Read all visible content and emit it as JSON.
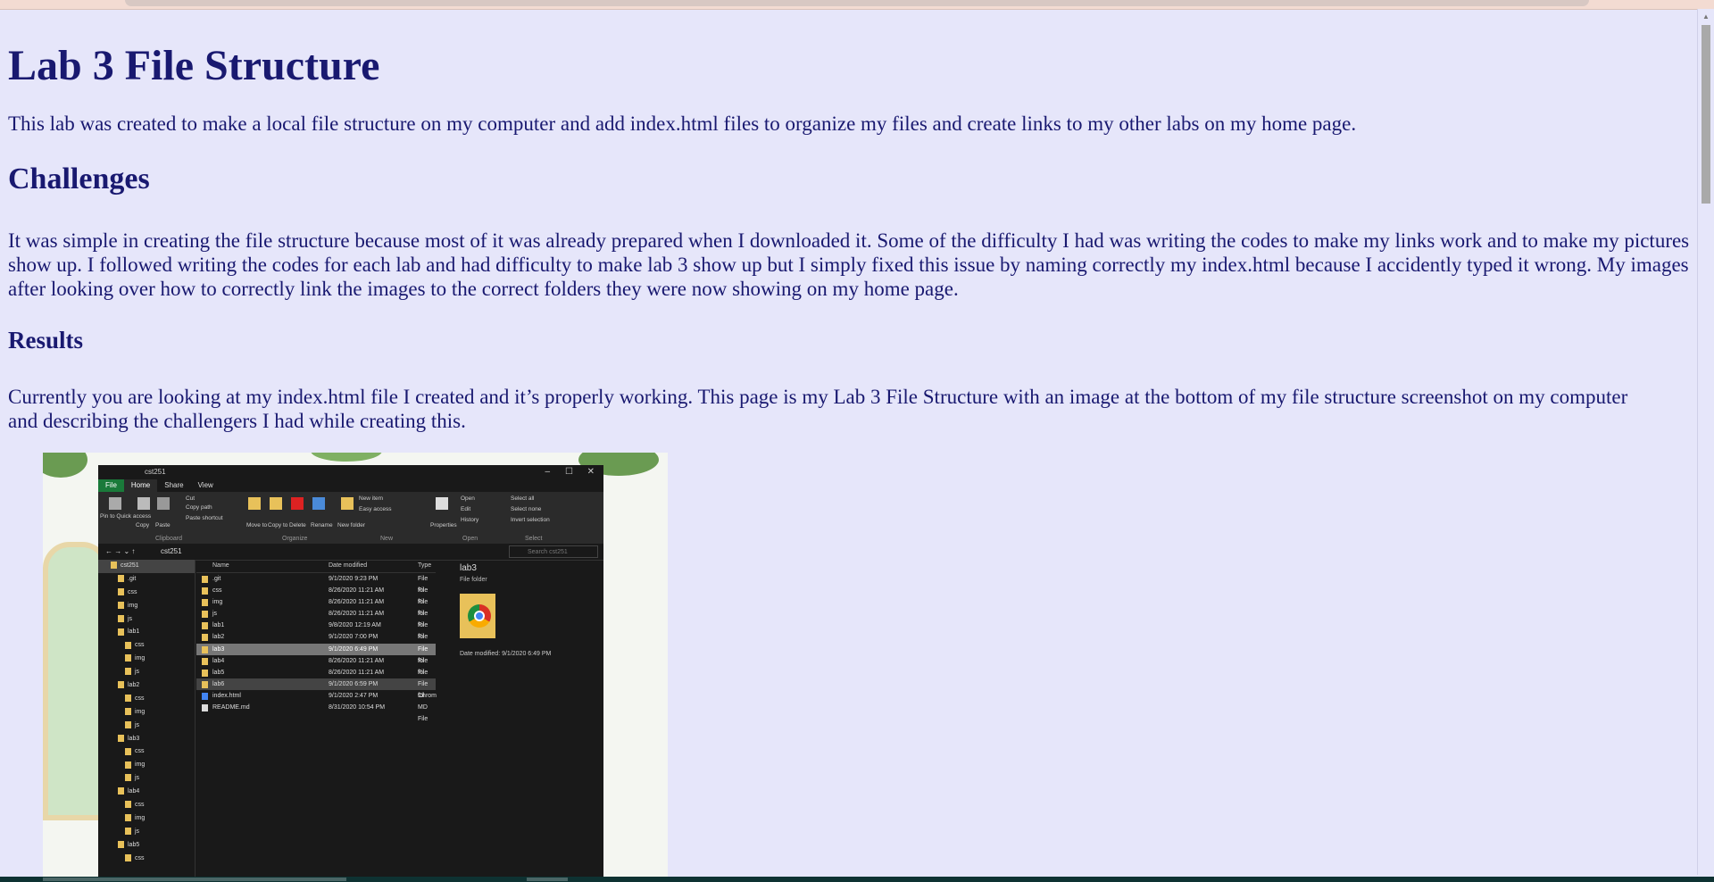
{
  "page": {
    "title": "Lab 3 File Structure",
    "intro": "This lab was created to make a local file structure on my computer and add index.html files to organize my files and create links to my other labs on my home page.",
    "challenges_heading": "Challenges",
    "challenges_text": "It was simple in creating the file structure because most of it was already prepared when I downloaded it. Some of the difficulty I had was writing the codes to make my links work and to make my pictures show up. I followed writing the codes for each lab and had difficulty to make lab 3 show up but I simply fixed this issue by naming correctly my index.html because I accidently typed it wrong. My images after looking over how to correctly link the images to the correct folders they were now showing on my home page.",
    "results_heading": "Results",
    "results_text": "Currently you are looking at my index.html file I created and it’s properly working. This page is my Lab 3 File Structure with an image at the bottom of my file structure screenshot on my computer and describing the challengers I had while creating this."
  },
  "screenshot": {
    "window_title": "cst251",
    "tabs": [
      "File",
      "Home",
      "Share",
      "View"
    ],
    "ribbon": {
      "clipboard": [
        "Pin to Quick access",
        "Copy",
        "Paste",
        "Cut",
        "Copy path",
        "Paste shortcut"
      ],
      "organize": [
        "Move to",
        "Copy to",
        "Delete",
        "Rename"
      ],
      "new": [
        "New folder",
        "New item",
        "Easy access"
      ],
      "open": [
        "Properties",
        "Open",
        "Edit",
        "History"
      ],
      "select": [
        "Select all",
        "Select none",
        "Invert selection"
      ],
      "groups": [
        "Clipboard",
        "Organize",
        "New",
        "Open",
        "Select"
      ]
    },
    "address_path": "cst251",
    "search_placeholder": "Search cst251",
    "tree": [
      "cst251",
      ".git",
      "css",
      "img",
      "js",
      "lab1",
      "css",
      "img",
      "js",
      "lab2",
      "css",
      "img",
      "js",
      "lab3",
      "css",
      "img",
      "js",
      "lab4",
      "css",
      "img",
      "js",
      "lab5",
      "css"
    ],
    "columns": [
      "Name",
      "Date modified",
      "Type"
    ],
    "files": [
      {
        "name": ".git",
        "date": "9/1/2020 9:23 PM",
        "type": "File fol"
      },
      {
        "name": "css",
        "date": "8/26/2020 11:21 AM",
        "type": "File fol"
      },
      {
        "name": "img",
        "date": "8/26/2020 11:21 AM",
        "type": "File fol"
      },
      {
        "name": "js",
        "date": "8/26/2020 11:21 AM",
        "type": "File fol"
      },
      {
        "name": "lab1",
        "date": "9/8/2020 12:19 AM",
        "type": "File fol"
      },
      {
        "name": "lab2",
        "date": "9/1/2020 7:00 PM",
        "type": "File fol"
      },
      {
        "name": "lab3",
        "date": "9/1/2020 6:49 PM",
        "type": "File fol"
      },
      {
        "name": "lab4",
        "date": "8/26/2020 11:21 AM",
        "type": "File fol"
      },
      {
        "name": "lab5",
        "date": "8/26/2020 11:21 AM",
        "type": "File fol"
      },
      {
        "name": "lab6",
        "date": "9/1/2020 6:59 PM",
        "type": "File fol"
      },
      {
        "name": "index.html",
        "date": "9/1/2020 2:47 PM",
        "type": "Chrom"
      },
      {
        "name": "README.md",
        "date": "8/31/2020 10:54 PM",
        "type": "MD File"
      }
    ],
    "preview": {
      "name": "lab3",
      "type": "File folder",
      "date_label": "Date modified:",
      "date_value": "9/1/2020 6:49 PM"
    }
  }
}
